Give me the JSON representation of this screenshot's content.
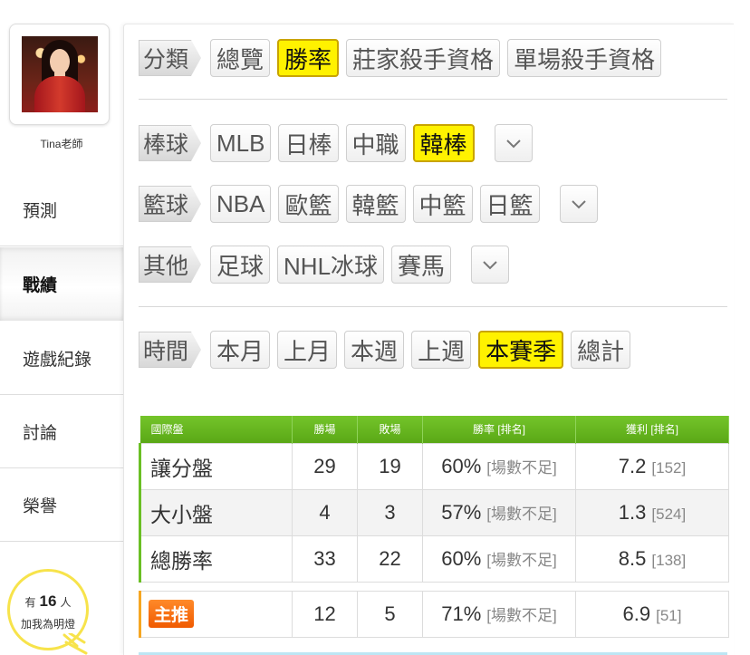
{
  "profile": {
    "username": "Tina老師"
  },
  "nav": [
    {
      "label": "預測",
      "active": false
    },
    {
      "label": "戰績",
      "active": true
    },
    {
      "label": "遊戲紀錄",
      "active": false
    },
    {
      "label": "討論",
      "active": false
    },
    {
      "label": "榮譽",
      "active": false
    }
  ],
  "lamp": {
    "prefix": "有",
    "count": "16",
    "suffix": "人",
    "caption": "加我為明燈"
  },
  "filters": {
    "category": {
      "label": "分類",
      "options": [
        "總覽",
        "勝率",
        "莊家殺手資格",
        "單場殺手資格"
      ],
      "selected": "勝率"
    },
    "baseball": {
      "label": "棒球",
      "options": [
        "MLB",
        "日棒",
        "中職",
        "韓棒"
      ],
      "selected": "韓棒"
    },
    "basketball": {
      "label": "籃球",
      "options": [
        "NBA",
        "歐籃",
        "韓籃",
        "中籃",
        "日籃"
      ],
      "selected": ""
    },
    "other": {
      "label": "其他",
      "options": [
        "足球",
        "NHL冰球",
        "賽馬"
      ],
      "selected": ""
    },
    "time": {
      "label": "時間",
      "options": [
        "本月",
        "上月",
        "本週",
        "上週",
        "本賽季",
        "總計"
      ],
      "selected": "本賽季"
    }
  },
  "table": {
    "headers": [
      "國際盤",
      "勝場",
      "敗場",
      "勝率 [排名]",
      "獲利 [排名]"
    ],
    "rows": [
      {
        "label": "讓分盤",
        "wins": "29",
        "losses": "19",
        "rate": "60%",
        "rate_note": "[場數不足]",
        "profit": "7.2",
        "profit_rank": "[152]"
      },
      {
        "label": "大小盤",
        "wins": "4",
        "losses": "3",
        "rate": "57%",
        "rate_note": "[場數不足]",
        "profit": "1.3",
        "profit_rank": "[524]"
      },
      {
        "label": "總勝率",
        "wins": "33",
        "losses": "22",
        "rate": "60%",
        "rate_note": "[場數不足]",
        "profit": "8.5",
        "profit_rank": "[138]"
      }
    ],
    "featured": {
      "badge": "主推",
      "wins": "12",
      "losses": "5",
      "rate": "71%",
      "rate_note": "[場數不足]",
      "profit": "6.9",
      "profit_rank": "[51]"
    }
  },
  "colors": {
    "selected": "#fff200",
    "header_green": "#6abf24",
    "badge_orange": "#f57a10",
    "lamp_yellow": "#f7e34b"
  }
}
